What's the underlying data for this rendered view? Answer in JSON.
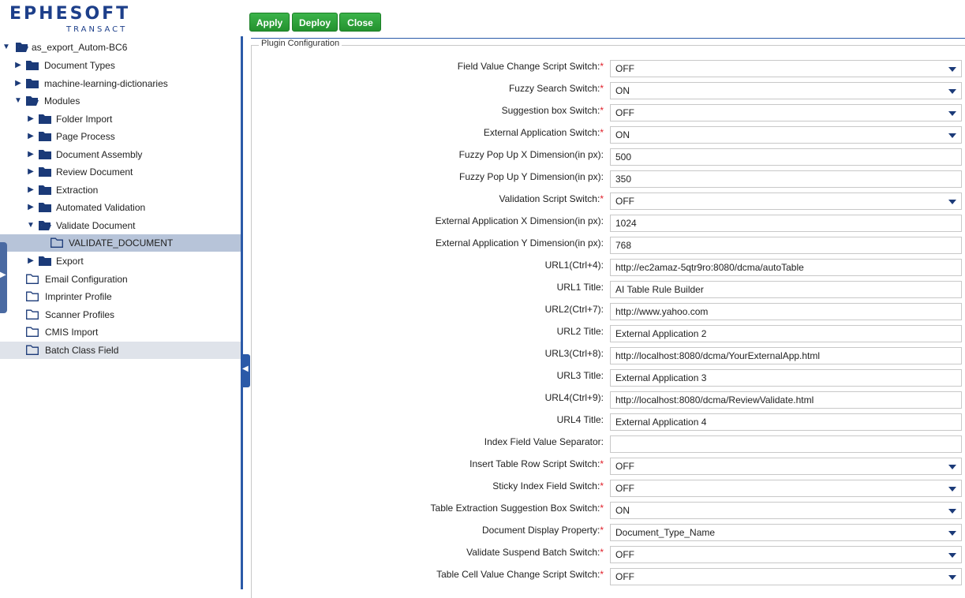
{
  "logo": {
    "brand": "EPHESOFT",
    "sub": "TRANSACT"
  },
  "toolbar": {
    "apply": "Apply",
    "deploy": "Deploy",
    "close": "Close"
  },
  "tree": [
    {
      "label": "as_export_Autom-BC6",
      "expanded": true,
      "icon": "folder-open-icon"
    },
    {
      "label": "Document Types",
      "icon": "folder-icon"
    },
    {
      "label": "machine-learning-dictionaries",
      "icon": "folder-icon"
    },
    {
      "label": "Modules",
      "expanded": true,
      "icon": "folder-open-icon"
    },
    {
      "label": "Folder Import",
      "icon": "folder-icon"
    },
    {
      "label": "Page Process",
      "icon": "folder-icon"
    },
    {
      "label": "Document Assembly",
      "icon": "folder-icon"
    },
    {
      "label": "Review Document",
      "icon": "folder-icon"
    },
    {
      "label": "Extraction",
      "icon": "folder-icon"
    },
    {
      "label": "Automated Validation",
      "icon": "folder-icon"
    },
    {
      "label": "Validate Document",
      "expanded": true,
      "icon": "folder-open-icon"
    },
    {
      "label": "VALIDATE_DOCUMENT",
      "selected": true,
      "icon": "folder-outline-icon"
    },
    {
      "label": "Export",
      "icon": "folder-icon"
    },
    {
      "label": "Email Configuration",
      "icon": "folder-outline-icon"
    },
    {
      "label": "Imprinter Profile",
      "icon": "folder-outline-icon"
    },
    {
      "label": "Scanner Profiles",
      "icon": "folder-outline-icon"
    },
    {
      "label": "CMIS Import",
      "icon": "folder-outline-icon"
    },
    {
      "label": "Batch Class Field",
      "hovered": true,
      "icon": "folder-outline-icon"
    }
  ],
  "panel": {
    "legend": "Plugin Configuration",
    "fields": [
      {
        "label": "Field Value Change Script Switch:",
        "required": true,
        "type": "select",
        "value": "OFF"
      },
      {
        "label": "Fuzzy Search Switch:",
        "required": true,
        "type": "select",
        "value": "ON"
      },
      {
        "label": "Suggestion box Switch:",
        "required": true,
        "type": "select",
        "value": "OFF"
      },
      {
        "label": "External Application Switch:",
        "required": true,
        "type": "select",
        "value": "ON"
      },
      {
        "label": "Fuzzy Pop Up X Dimension(in px):",
        "required": false,
        "type": "text",
        "value": "500"
      },
      {
        "label": "Fuzzy Pop Up Y Dimension(in px):",
        "required": false,
        "type": "text",
        "value": "350"
      },
      {
        "label": "Validation Script Switch:",
        "required": true,
        "type": "select",
        "value": "OFF"
      },
      {
        "label": "External Application X Dimension(in px):",
        "required": false,
        "type": "text",
        "value": "1024"
      },
      {
        "label": "External Application Y Dimension(in px):",
        "required": false,
        "type": "text",
        "value": "768"
      },
      {
        "label": "URL1(Ctrl+4):",
        "required": false,
        "type": "text",
        "value": "http://ec2amaz-5qtr9ro:8080/dcma/autoTable"
      },
      {
        "label": "URL1 Title:",
        "required": false,
        "type": "text",
        "value": "AI Table Rule Builder"
      },
      {
        "label": "URL2(Ctrl+7):",
        "required": false,
        "type": "text",
        "value": "http://www.yahoo.com"
      },
      {
        "label": "URL2 Title:",
        "required": false,
        "type": "text",
        "value": "External Application 2"
      },
      {
        "label": "URL3(Ctrl+8):",
        "required": false,
        "type": "text",
        "value": "http://localhost:8080/dcma/YourExternalApp.html"
      },
      {
        "label": "URL3 Title:",
        "required": false,
        "type": "text",
        "value": "External Application 3"
      },
      {
        "label": "URL4(Ctrl+9):",
        "required": false,
        "type": "text",
        "value": "http://localhost:8080/dcma/ReviewValidate.html"
      },
      {
        "label": "URL4 Title:",
        "required": false,
        "type": "text",
        "value": "External Application 4"
      },
      {
        "label": "Index Field Value Separator:",
        "required": false,
        "type": "text",
        "value": ""
      },
      {
        "label": "Insert Table Row Script Switch:",
        "required": true,
        "type": "select",
        "value": "OFF"
      },
      {
        "label": "Sticky Index Field Switch:",
        "required": true,
        "type": "select",
        "value": "OFF"
      },
      {
        "label": "Table Extraction Suggestion Box Switch:",
        "required": true,
        "type": "select",
        "value": "ON"
      },
      {
        "label": "Document Display Property:",
        "required": true,
        "type": "select",
        "value": "Document_Type_Name"
      },
      {
        "label": "Validate Suspend Batch Switch:",
        "required": true,
        "type": "select",
        "value": "OFF"
      },
      {
        "label": "Table Cell Value Change Script Switch:",
        "required": true,
        "type": "select",
        "value": "OFF"
      }
    ]
  },
  "colors": {
    "accent": "#2b5aa8",
    "button": "#24922f",
    "selected_row": "#b7c4d9",
    "required": "#e0202a"
  }
}
